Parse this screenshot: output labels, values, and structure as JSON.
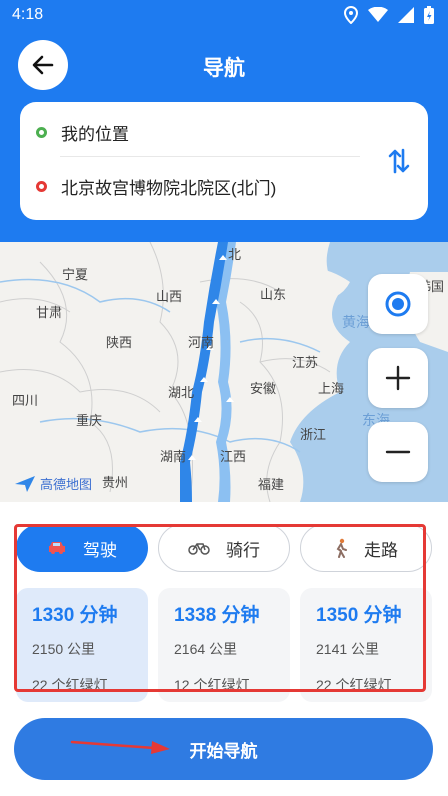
{
  "status_bar": {
    "time": "4:18"
  },
  "header": {
    "title": "导航"
  },
  "route": {
    "from": "我的位置",
    "to": "北京故宫博物院北院区(北门)"
  },
  "map": {
    "labels": [
      {
        "key": "ningxia",
        "text": "宁夏"
      },
      {
        "key": "gansu",
        "text": "甘肃"
      },
      {
        "key": "shanxi",
        "text": "山西"
      },
      {
        "key": "shandong",
        "text": "山东"
      },
      {
        "key": "shaanxi",
        "text": "陕西"
      },
      {
        "key": "henan",
        "text": "河南"
      },
      {
        "key": "sichuan",
        "text": "四川"
      },
      {
        "key": "chongqing",
        "text": "重庆"
      },
      {
        "key": "hubei",
        "text": "湖北"
      },
      {
        "key": "anhui",
        "text": "安徽"
      },
      {
        "key": "jiangsu",
        "text": "江苏"
      },
      {
        "key": "shanghai",
        "text": "上海"
      },
      {
        "key": "zhejiang",
        "text": "浙江"
      },
      {
        "key": "hunan",
        "text": "湖南"
      },
      {
        "key": "jiangxi",
        "text": "江西"
      },
      {
        "key": "guizhou",
        "text": "贵州"
      },
      {
        "key": "fujian",
        "text": "福建"
      },
      {
        "key": "huanghai",
        "text": "黄海"
      },
      {
        "key": "donghai",
        "text": "东海"
      },
      {
        "key": "hanguo",
        "text": "韩国"
      },
      {
        "key": "beijing",
        "text": "北"
      }
    ],
    "logo_text": "高德地图"
  },
  "modes": [
    {
      "label": "驾驶",
      "icon": "car-icon"
    },
    {
      "label": "骑行",
      "icon": "bicycle-icon"
    },
    {
      "label": "走路",
      "icon": "walking-icon"
    }
  ],
  "options": [
    {
      "time": "1330 分钟",
      "distance": "2150 公里",
      "lights": "22 个红绿灯"
    },
    {
      "time": "1338 分钟",
      "distance": "2164 公里",
      "lights": "12 个红绿灯"
    },
    {
      "time": "1350 分钟",
      "distance": "2141 公里",
      "lights": "22 个红绿灯"
    }
  ],
  "nav_button": {
    "label": "开始导航"
  },
  "colors": {
    "primary": "#1e7bf0",
    "route": "#2f86e8",
    "alt_route": "#8cc0f2",
    "highlight": "#e53935"
  }
}
